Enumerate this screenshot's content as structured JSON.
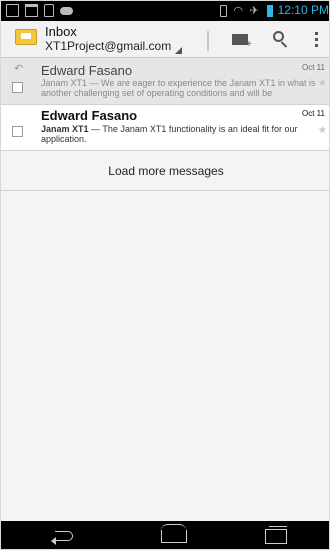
{
  "status_bar": {
    "time": "12:10 PM",
    "left_icons": [
      "screenshot-icon",
      "chat-icon",
      "shopping-bag-icon",
      "game-controller-icon"
    ],
    "right_icons": [
      "vibrate-icon",
      "wifi-icon",
      "airplane-icon",
      "battery-icon"
    ]
  },
  "action_bar": {
    "title": "Inbox",
    "account": "XT1Project@gmail.com",
    "actions": [
      "compose-icon",
      "search-icon",
      "overflow-menu-icon"
    ]
  },
  "messages": [
    {
      "sender": "Edward Fasano",
      "date": "Oct 11",
      "subject": "Janam XT1",
      "dash": " — ",
      "preview": "We are eager to experience the Janam XT1 in what is another challenging set of operating conditions and will be",
      "read": true,
      "replied": true,
      "starred": false
    },
    {
      "sender": "Edward Fasano",
      "date": "Oct 11",
      "subject": "Janam XT1",
      "dash": " — ",
      "preview": "The Janam XT1 functionality is an ideal fit for our application.",
      "read": false,
      "replied": false,
      "starred": false
    }
  ],
  "load_more_label": "Load more messages",
  "glyphs": {
    "reply": "↶",
    "star": "★",
    "wifi": "◠",
    "plane": "✈",
    "plus": "+"
  },
  "colors": {
    "accent": "#33b5e5",
    "read_bg": "#e6e6e6",
    "unread_bg": "#ffffff",
    "inbox_icon": "#f2c740"
  }
}
